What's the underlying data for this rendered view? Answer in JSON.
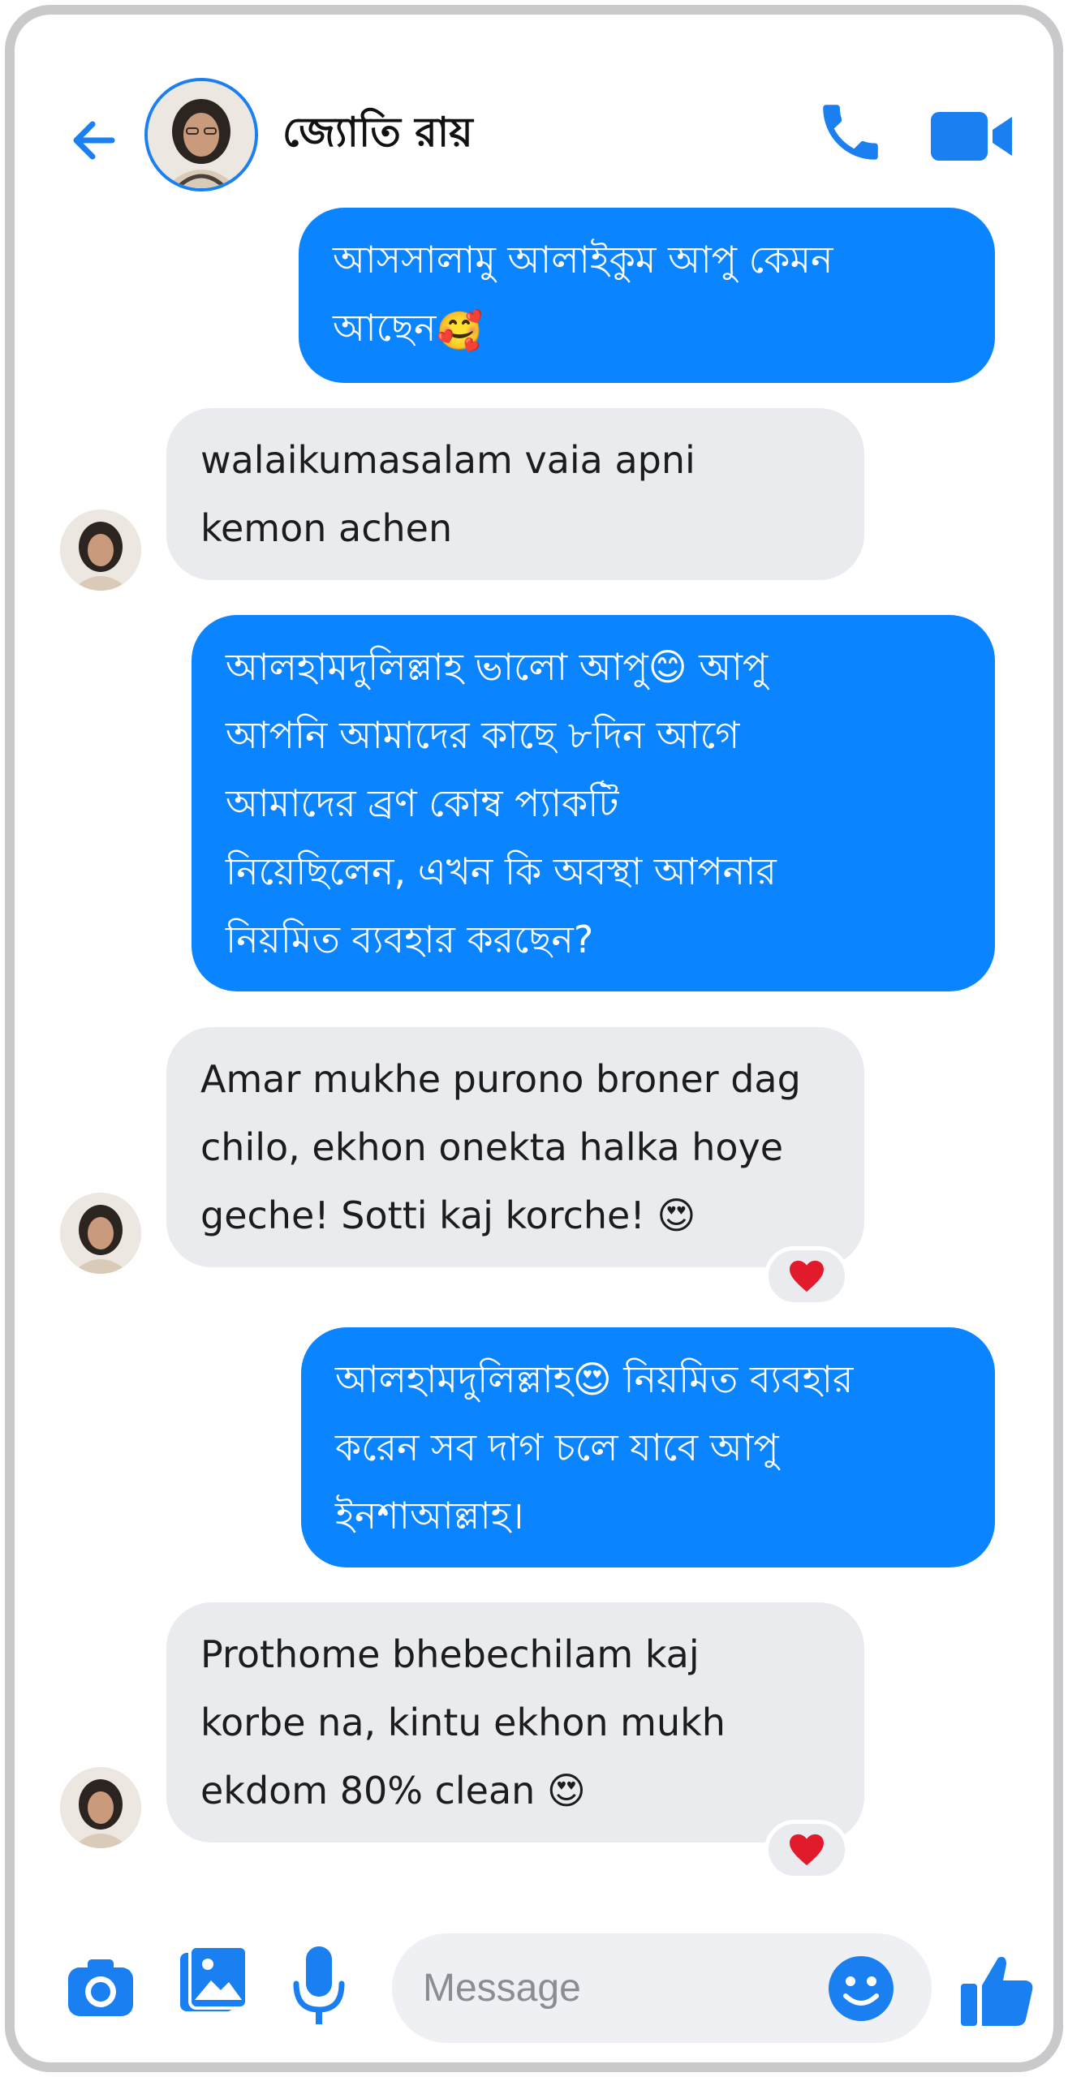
{
  "header": {
    "contact_name": "জ্যোতি রায়",
    "back_icon": "arrow-left-icon",
    "call_icon": "phone-icon",
    "video_icon": "video-camera-icon"
  },
  "messages": [
    {
      "direction": "outgoing",
      "text": "আসসালামু আলাইকুম আপু কেমন\nআছেন",
      "emoji": "🥰"
    },
    {
      "direction": "incoming",
      "text": "walaikumasalam vaia apni\nkemon achen"
    },
    {
      "direction": "outgoing",
      "text": "আলহামদুলিল্লাহ ভালো আপু😊 আপু\nআপনি আমাদের কাছে ৮দিন আগে\nআমাদের ব্রণ কোম্ব প্যাকটি\nনিয়েছিলেন, এখন কি অবস্থা আপনার\nনিয়মিত ব্যবহার করছেন?"
    },
    {
      "direction": "incoming",
      "text": "Amar mukhe purono broner dag\nchilo, ekhon onekta halka hoye\ngeche! Sotti kaj korche! 😍",
      "reaction": "❤️"
    },
    {
      "direction": "outgoing",
      "text": "আলহামদুলিল্লাহ😍 নিয়মিত ব্যবহার\nকরেন সব দাগ চলে যাবে আপু\nইনশাআল্লাহ।"
    },
    {
      "direction": "incoming",
      "text": "Prothome bhebechilam kaj\nkorbe na, kintu ekhon mukh\nekdom 80% clean 😍",
      "reaction": "❤️"
    }
  ],
  "composer": {
    "placeholder": "Message",
    "camera_icon": "camera-icon",
    "gallery_icon": "gallery-icon",
    "mic_icon": "microphone-icon",
    "emoji_icon": "smiley-icon",
    "like_icon": "thumbs-up-icon"
  },
  "colors": {
    "accent": "#0a84ff",
    "incoming_bubble": "#e9ebef",
    "frame": "#c9c9cb"
  }
}
